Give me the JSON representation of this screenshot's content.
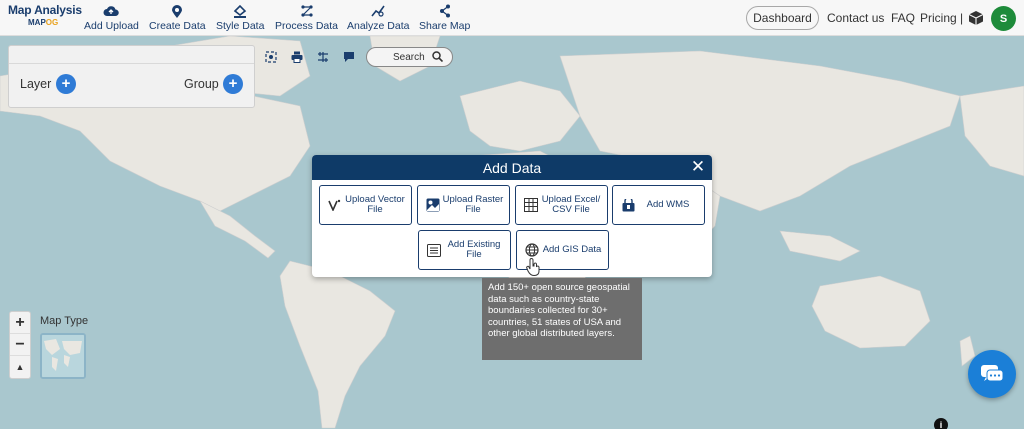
{
  "header": {
    "logo_title": "Map Analysis",
    "logo_sub_a": "MAP",
    "logo_sub_b": "OG",
    "nav": [
      {
        "label": "Add Upload",
        "icon": "cloud-upload-icon"
      },
      {
        "label": "Create Data",
        "icon": "map-pin-icon"
      },
      {
        "label": "Style Data",
        "icon": "paint-bucket-icon"
      },
      {
        "label": "Process Data",
        "icon": "process-icon"
      },
      {
        "label": "Analyze Data",
        "icon": "analyze-icon"
      },
      {
        "label": "Share Map",
        "icon": "share-icon"
      }
    ],
    "dashboard": "Dashboard",
    "contact": "Contact us",
    "faq": "FAQ",
    "pricing": "Pricing |",
    "avatar_initial": "S"
  },
  "layer_panel": {
    "layer_label": "Layer",
    "group_label": "Group",
    "plus": "+"
  },
  "search": {
    "label": "Search"
  },
  "modal": {
    "title": "Add Data",
    "close": "✕",
    "options": [
      {
        "label": "Upload Vector File",
        "icon": "vector-icon"
      },
      {
        "label": "Upload Raster File",
        "icon": "image-icon"
      },
      {
        "label": "Upload Excel/ CSV File",
        "icon": "spreadsheet-icon"
      },
      {
        "label": "Add WMS",
        "icon": "wms-icon"
      },
      {
        "label": "Add Existing File",
        "icon": "file-list-icon"
      },
      {
        "label": "Add GIS Data",
        "icon": "globe-icon"
      }
    ]
  },
  "tooltip": {
    "text": "Add 150+ open source geospatial data such as country-state boundaries collected for 30+ countries, 51 states of USA and other global distributed layers."
  },
  "map_controls": {
    "zoom_in": "+",
    "zoom_out": "−",
    "reset": "▲",
    "map_type_label": "Map Type"
  },
  "info_badge": "i",
  "colors": {
    "brand": "#1a3d6d",
    "modal_header": "#0e3a67",
    "accent": "#2f7bd6",
    "chat": "#1b7fd7",
    "avatar": "#1e8b3a",
    "water": "#a9c7ce",
    "land": "#e9e7e1"
  }
}
